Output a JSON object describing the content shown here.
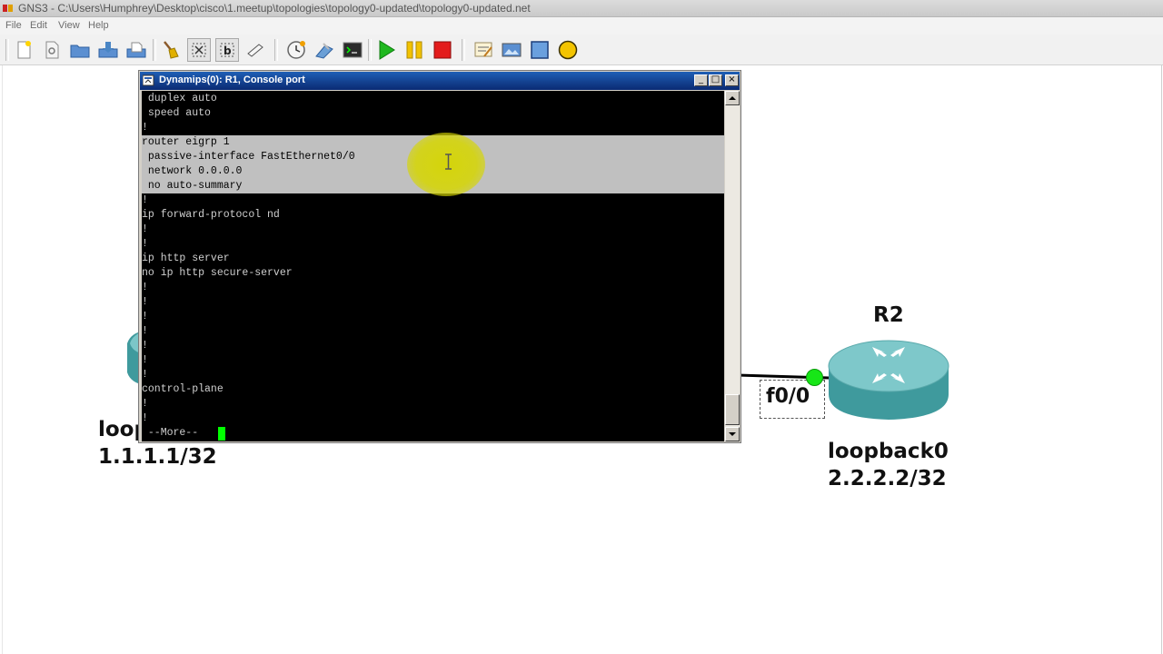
{
  "window": {
    "title": "GNS3 - C:\\Users\\Humphrey\\Desktop\\cisco\\1.meetup\\topologies\\topology0-updated\\topology0-updated.net"
  },
  "menu": {
    "items": [
      {
        "label": "File"
      },
      {
        "label": "Edit"
      },
      {
        "label": "View"
      },
      {
        "label": "Help"
      }
    ]
  },
  "toolbar": {
    "buttons": [
      {
        "icon": "new-project-icon"
      },
      {
        "icon": "open-icon"
      },
      {
        "icon": "open-folder-icon"
      },
      {
        "icon": "save-icon"
      },
      {
        "icon": "save-as-icon"
      },
      {
        "icon": "broom-icon"
      },
      {
        "icon": "show-interface-labels-icon"
      },
      {
        "icon": "show-hostnames-icon"
      },
      {
        "icon": "add-link-icon"
      },
      {
        "icon": "clock-icon"
      },
      {
        "icon": "capture-icon"
      },
      {
        "icon": "console-icon"
      },
      {
        "icon": "start-icon"
      },
      {
        "icon": "pause-icon"
      },
      {
        "icon": "stop-icon"
      },
      {
        "icon": "note-icon"
      },
      {
        "icon": "insert-picture-icon"
      },
      {
        "icon": "rectangle-icon"
      },
      {
        "icon": "ellipse-icon"
      }
    ]
  },
  "console": {
    "title": "Dynamips(0): R1, Console port",
    "buttons": {
      "minimize": "_",
      "maximize": "□",
      "close": "×"
    },
    "lines": [
      " duplex auto",
      " speed auto",
      "!",
      "router eigrp 1",
      " passive-interface FastEthernet0/0",
      " network 0.0.0.0",
      " no auto-summary",
      "!",
      "ip forward-protocol nd",
      "!",
      "!",
      "ip http server",
      "no ip http secure-server",
      "!",
      "!",
      "!",
      "!",
      "!",
      "!",
      "!",
      "control-plane",
      "!",
      "!",
      " --More-- "
    ],
    "selected_lines": [
      3,
      4,
      5,
      6
    ],
    "colors": {
      "background": "#000000",
      "text": "#cfcfcf",
      "selection": "#c0c0c0",
      "cursor": "#00ff00",
      "titlebar": "#0a246a"
    }
  },
  "topology": {
    "r1": {
      "label_partial": "loop",
      "address": "1.1.1.1/32"
    },
    "r2": {
      "hostname": "R2",
      "interface_label": "f0/0",
      "loopback_label": "loopback0",
      "loopback_address": "2.2.2.2/32"
    },
    "colors": {
      "router_body": "#3f9a9d",
      "link_status_up": "#17e617",
      "link": "#000000"
    }
  }
}
